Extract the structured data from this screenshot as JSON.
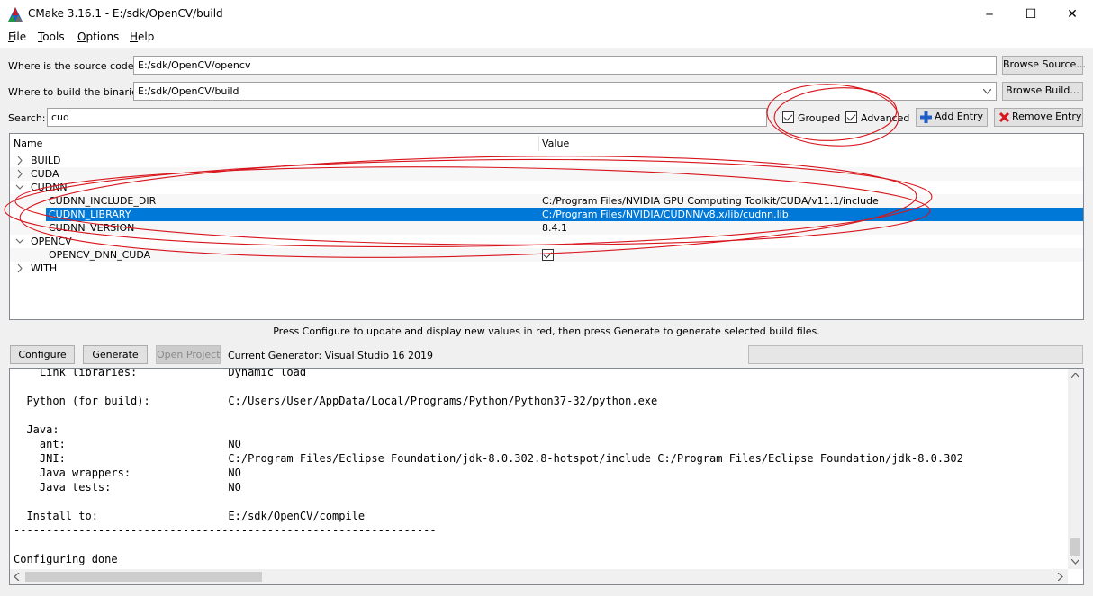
{
  "window": {
    "title": "CMake 3.16.1 - E:/sdk/OpenCV/build",
    "minimize_glyph": "─",
    "maximize_glyph": "☐",
    "close_glyph": "✕"
  },
  "menu": [
    {
      "underline": "F",
      "rest": "ile"
    },
    {
      "underline": "T",
      "rest": "ools"
    },
    {
      "underline": "O",
      "rest": "ptions"
    },
    {
      "underline": "H",
      "rest": "elp"
    }
  ],
  "source": {
    "label": "Where is the source code:",
    "value": "E:/sdk/OpenCV/opencv",
    "browse_label": "Browse Source..."
  },
  "build": {
    "label": "Where to build the binaries:",
    "value": "E:/sdk/OpenCV/build",
    "browse_label": "Browse Build..."
  },
  "search": {
    "label": "Search:",
    "value": "cud",
    "grouped_label": "Grouped",
    "grouped_checked": true,
    "advanced_label": "Advanced",
    "advanced_checked": true,
    "add_entry_label": "Add Entry",
    "remove_entry_label": "Remove Entry"
  },
  "tree": {
    "col_name": "Name",
    "col_value": "Value",
    "rows": [
      {
        "name": "BUILD",
        "value": "",
        "level": 0,
        "expanded": false
      },
      {
        "name": "CUDA",
        "value": "",
        "level": 0,
        "expanded": false
      },
      {
        "name": "CUDNN",
        "value": "",
        "level": 0,
        "expanded": true
      },
      {
        "name": "CUDNN_INCLUDE_DIR",
        "value": "C:/Program Files/NVIDIA GPU Computing Toolkit/CUDA/v11.1/include",
        "level": 1
      },
      {
        "name": "CUDNN_LIBRARY",
        "value": "C:/Program Files/NVIDIA/CUDNN/v8.x/lib/cudnn.lib",
        "level": 1,
        "selected": true
      },
      {
        "name": "CUDNN_VERSION",
        "value": "8.4.1",
        "level": 1
      },
      {
        "name": "OPENCV",
        "value": "",
        "level": 0,
        "expanded": true
      },
      {
        "name": "OPENCV_DNN_CUDA",
        "value": "",
        "level": 1,
        "checkbox": true
      },
      {
        "name": "WITH",
        "value": "",
        "level": 0,
        "expanded": false
      }
    ]
  },
  "status_text": "Press Configure to update and display new values in red, then press Generate to generate selected build files.",
  "actions": {
    "configure_label": "Configure",
    "generate_label": "Generate",
    "open_project_label": "Open Project",
    "generator_text": "Current Generator: Visual Studio 16 2019"
  },
  "output_lines": [
    "    Link libraries:              Dynamic load",
    "",
    "  Python (for build):            C:/Users/User/AppData/Local/Programs/Python/Python37-32/python.exe",
    "",
    "  Java:",
    "    ant:                         NO",
    "    JNI:                         C:/Program Files/Eclipse Foundation/jdk-8.0.302.8-hotspot/include C:/Program Files/Eclipse Foundation/jdk-8.0.302",
    "    Java wrappers:               NO",
    "    Java tests:                  NO",
    "",
    "  Install to:                    E:/sdk/OpenCV/compile",
    "-----------------------------------------------------------------",
    "",
    "Configuring done"
  ],
  "annotation_color": "#d8141c"
}
